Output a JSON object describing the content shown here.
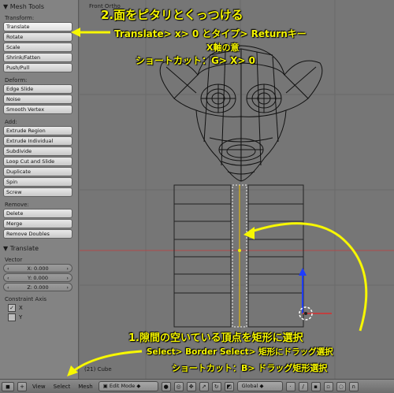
{
  "shelf": {
    "title": "Mesh Tools",
    "transform_label": "Transform:",
    "transform": [
      "Translate",
      "Rotate",
      "Scale",
      "Shrink/Fatten",
      "Push/Pull"
    ],
    "deform_label": "Deform:",
    "deform": [
      "Edge Slide",
      "Noise",
      "Smooth Vertex"
    ],
    "add_label": "Add:",
    "add": [
      "Extrude Region",
      "Extrude Individual",
      "Subdivide",
      "Loop Cut and Slide",
      "Duplicate",
      "Spin",
      "Screw"
    ],
    "remove_label": "Remove:",
    "remove": [
      "Delete",
      "Merge",
      "Remove Doubles"
    ],
    "operator_title": "Translate",
    "vector_label": "Vector",
    "vector": [
      "X: 0.000",
      "Y: 0.000",
      "Z: 0.000"
    ],
    "constraint_label": "Constraint Axis",
    "constraint_axes": [
      {
        "label": "X",
        "checked": true
      },
      {
        "label": "Y",
        "checked": false
      }
    ]
  },
  "viewport": {
    "view_label": "Front Ortho",
    "object_label": "(21) Cube"
  },
  "header": {
    "menus": [
      "View",
      "Select",
      "Mesh"
    ],
    "mode": "Edit Mode",
    "orientation": "Global"
  },
  "annotations": {
    "top_title": "2.面をピタリとくっつける",
    "top_line1": "Translate> x> 0 とタイプ> Returnキー",
    "top_line2": "X軸の意",
    "top_line3": "ショートカット：G> X> 0",
    "bottom_title": "1.隙間の空いている頂点を矩形に選択",
    "bottom_line1": "Select> Border Select> 矩形にドラッグ選択",
    "bottom_line2": "ショートカット：B> ドラッグ矩形選択"
  },
  "colors": {
    "annotation": "#f7f700",
    "wire": "#111111",
    "z_axis": "#1e3cff"
  }
}
